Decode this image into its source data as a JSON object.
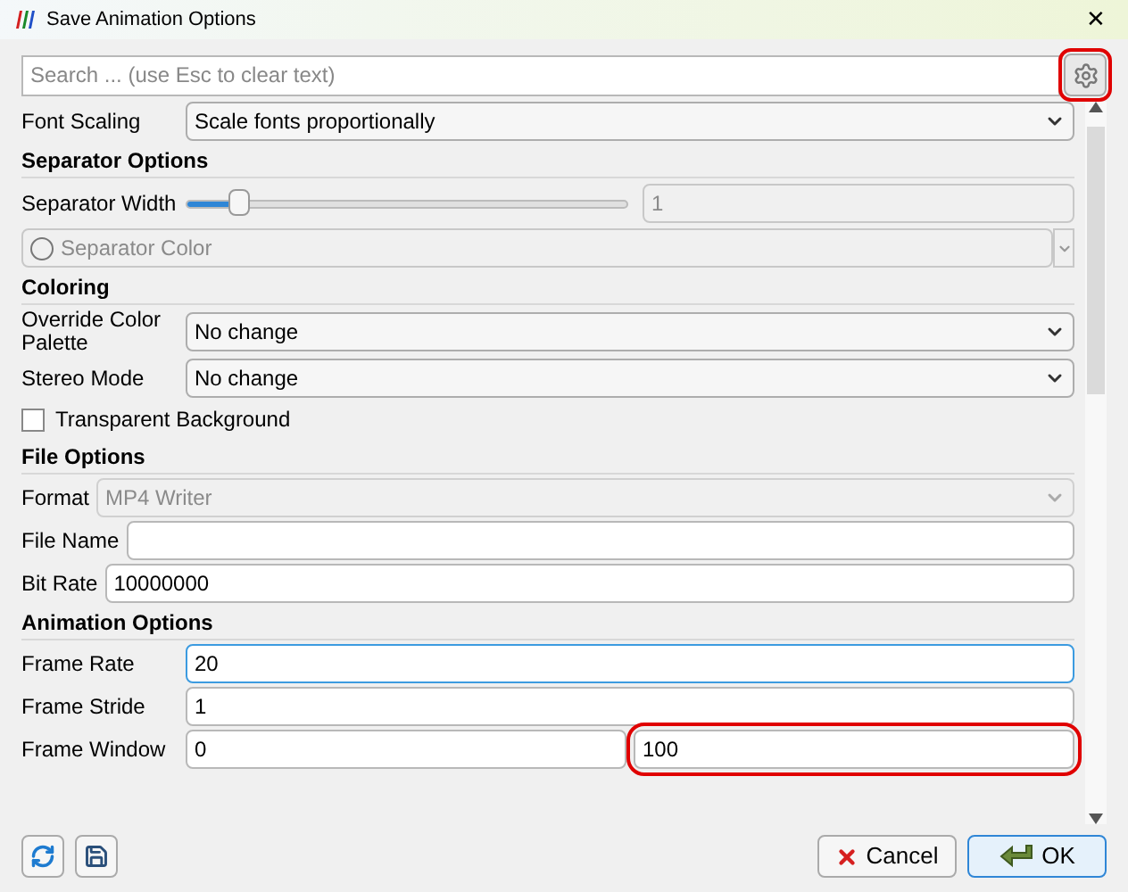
{
  "window": {
    "title": "Save Animation Options",
    "close": "✕"
  },
  "search": {
    "placeholder": "Search ... (use Esc to clear text)",
    "settings_highlighted": true
  },
  "rows": [
    {
      "kind": "combo",
      "label": "Font Scaling",
      "value": "Scale fonts proportionally",
      "disabled": false
    },
    {
      "kind": "header",
      "label": "Separator Options"
    },
    {
      "kind": "slider",
      "label": "Separator Width",
      "level": 0.12,
      "value": "1"
    },
    {
      "kind": "color",
      "label": "Separator Color"
    },
    {
      "kind": "header",
      "label": "Coloring"
    },
    {
      "kind": "combo",
      "label": "Override Color Palette",
      "value": "No change",
      "disabled": false
    },
    {
      "kind": "combo",
      "label": "Stereo Mode",
      "value": "No change",
      "disabled": false
    },
    {
      "kind": "checkbox",
      "label": "Transparent Background",
      "checked": false
    },
    {
      "kind": "header",
      "label": "File Options"
    },
    {
      "kind": "combo",
      "label": "Format",
      "value": "MP4 Writer",
      "disabled": true
    },
    {
      "kind": "text",
      "label": "File Name",
      "values": [
        {
          "focused": false,
          "highlighted": false
        }
      ]
    },
    {
      "kind": "text",
      "label": "Bit Rate",
      "values": [
        {
          "value": "10000000",
          "focused": false,
          "highlighted": false
        }
      ]
    },
    {
      "kind": "header",
      "label": "Animation Options"
    },
    {
      "kind": "text",
      "label": "Frame Rate",
      "values": [
        {
          "value": "20",
          "focused": true,
          "highlighted": false
        }
      ]
    },
    {
      "kind": "text",
      "label": "Frame Stride",
      "values": [
        {
          "value": "1",
          "focused": false,
          "highlighted": false
        }
      ]
    },
    {
      "kind": "text",
      "label": "Frame Window",
      "values": [
        {
          "value": "0",
          "focused": false,
          "highlighted": false
        },
        {
          "value": "100",
          "focused": false,
          "highlighted": true
        }
      ]
    }
  ],
  "buttons": [
    {
      "label": "Cancel",
      "kind": "cancel",
      "default": false
    },
    {
      "label": "OK",
      "kind": "ok",
      "default": true
    }
  ]
}
